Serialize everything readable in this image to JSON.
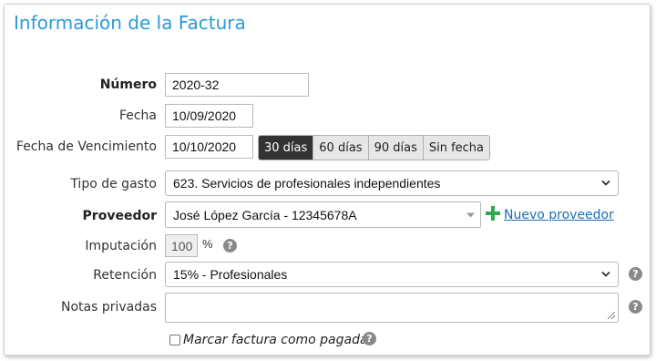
{
  "title": "Información de la Factura",
  "numero": {
    "label": "Número",
    "value": "2020-32"
  },
  "fecha": {
    "label": "Fecha",
    "value": "10/09/2020"
  },
  "vencimiento": {
    "label": "Fecha de Vencimiento",
    "value": "10/10/2020",
    "options": [
      "30 días",
      "60 días",
      "90 días",
      "Sin fecha"
    ],
    "active": "30 días"
  },
  "tipo_gasto": {
    "label": "Tipo de gasto",
    "value": "623. Servicios de profesionales independientes"
  },
  "proveedor": {
    "label": "Proveedor",
    "value": "José López García - 12345678A",
    "link": "Nuevo proveedor"
  },
  "imputacion": {
    "label": "Imputación",
    "value": "100",
    "unit": "%"
  },
  "retencion": {
    "label": "Retención",
    "value": "15% - Profesionales"
  },
  "notas": {
    "label": "Notas privadas",
    "value": ""
  },
  "pagada": {
    "label": "Marcar factura como pagada",
    "checked": false
  },
  "help_glyph": "?",
  "plus_glyph": "+",
  "caret_glyph": "⌄",
  "colors": {
    "title": "#2b9bd6",
    "link": "#1a6fb5",
    "plus": "#2fa84f",
    "active_segment": "#333333"
  }
}
